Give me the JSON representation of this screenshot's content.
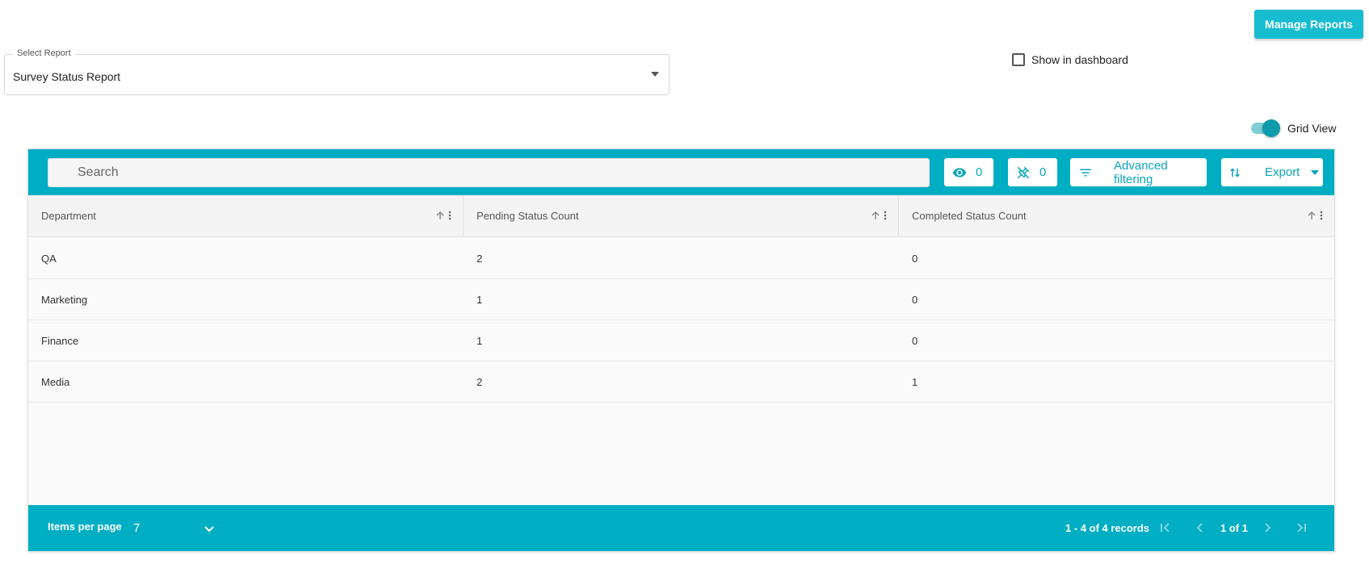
{
  "header": {
    "manage_reports_label": "Manage Reports"
  },
  "report_select": {
    "legend": "Select Report",
    "value": "Survey Status Report"
  },
  "dashboard_checkbox": {
    "label": "Show in dashboard",
    "checked": false
  },
  "view_toggle": {
    "label": "Grid View",
    "on": true
  },
  "toolbar": {
    "search_placeholder": "Search",
    "visible_columns_count": "0",
    "pinned_columns_count": "0",
    "advanced_filtering_label": "Advanced filtering",
    "export_label": "Export",
    "accent_color": "#00aec4"
  },
  "table": {
    "columns": [
      "Department",
      "Pending Status Count",
      "Completed Status Count"
    ],
    "rows": [
      [
        "QA",
        "2",
        "0"
      ],
      [
        "Marketing",
        "1",
        "0"
      ],
      [
        "Finance",
        "1",
        "0"
      ],
      [
        "Media",
        "2",
        "1"
      ]
    ]
  },
  "footer": {
    "items_per_page_label": "Items per page",
    "items_per_page_value": "7",
    "records_text": "1 - 4 of 4 records",
    "page_text": "1 of 1"
  },
  "icons": {
    "search": "search-icon",
    "visibility": "eye-icon",
    "pin": "unpin-icon",
    "filter": "filter-icon",
    "export": "sort-arrows-icon",
    "sort": "arrow-up-icon",
    "menu": "more-vert-icon"
  }
}
